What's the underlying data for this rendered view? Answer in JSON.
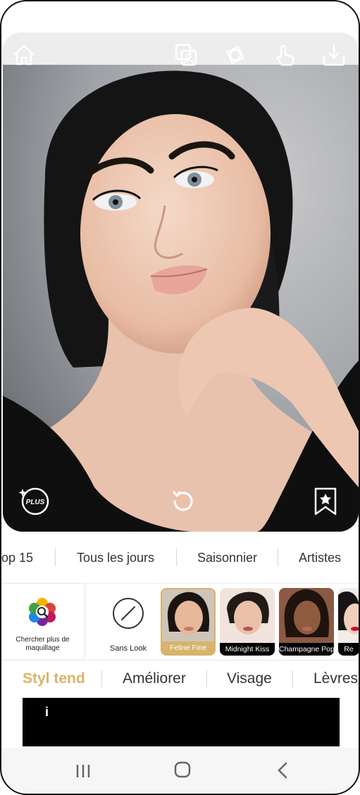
{
  "top_toolbar": {
    "icons": [
      "home-icon",
      "compare-photos-icon",
      "face-rotate-icon",
      "touch-icon",
      "download-icon"
    ]
  },
  "photo_controls": {
    "plus_badge": "PLUS",
    "icons": [
      "plus-sparkle-icon",
      "reset-icon",
      "bookmark-star-icon"
    ]
  },
  "categories": [
    "op 15",
    "Tous les jours",
    "Saisonnier",
    "Artistes"
  ],
  "looks": {
    "search_label": "Chercher plus de maquillage",
    "none_label": "Sans Look",
    "cards": [
      {
        "name": "Feline Fine",
        "selected": true
      },
      {
        "name": "Midnight Kiss",
        "selected": false
      },
      {
        "name": "Champagne Pop",
        "selected": false
      },
      {
        "name": "Re",
        "selected": false
      }
    ]
  },
  "features": {
    "tabs": [
      "Styl tend",
      "Améliorer",
      "Visage",
      "Lèvres"
    ],
    "active": "Styl tend"
  },
  "panel": {
    "info_text": "i"
  },
  "nav": {
    "icons": [
      "recent-apps-icon",
      "home-circle-icon",
      "back-icon"
    ]
  },
  "colors": {
    "accent": "#d9b56a",
    "panel": "#000000"
  }
}
